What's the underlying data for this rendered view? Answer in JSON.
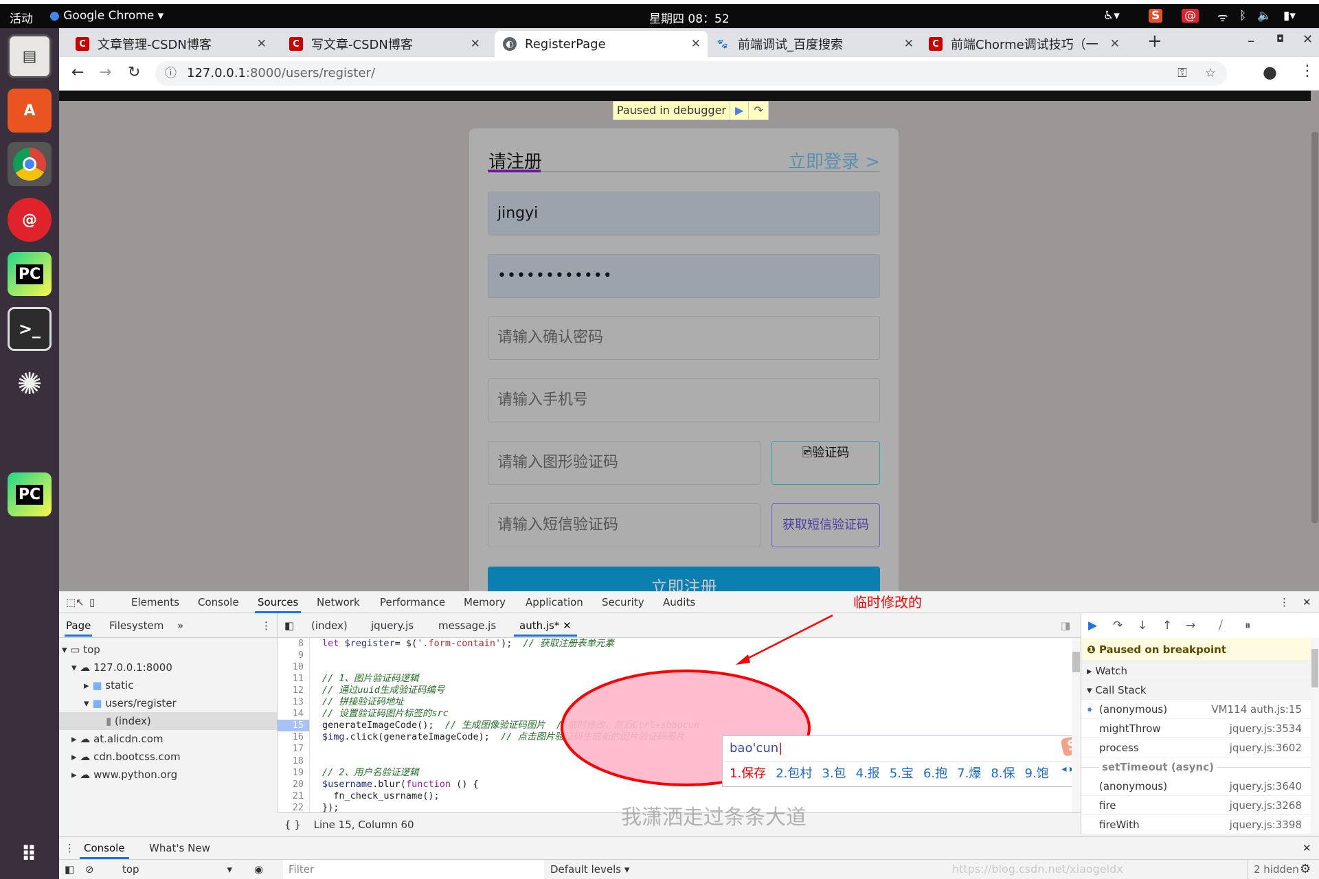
{
  "os": {
    "activities": "活动",
    "app_menu": "Google Chrome ▾",
    "clock": "星期四 08：52"
  },
  "dock": [
    "files-icon",
    "software-icon",
    "chrome-icon",
    "netease-music-icon",
    "pycharm-icon",
    "terminal-icon",
    "inkscape-icon",
    "pycharm-pro-icon",
    "app-grid-icon"
  ],
  "tabs": [
    {
      "title": "文章管理-CSDN博客",
      "fav": "C"
    },
    {
      "title": "写文章-CSDN博客",
      "fav": "C"
    },
    {
      "title": "RegisterPage",
      "fav": ""
    },
    {
      "title": "前端调试_百度搜索",
      "fav": "🐾"
    },
    {
      "title": "前端Chorme调试技巧（一",
      "fav": "C"
    }
  ],
  "address": {
    "host": "127.0.0.1",
    "rest": ":8000/users/register/"
  },
  "debugger_overlay": "Paused in debugger",
  "form": {
    "title": "请注册",
    "login_link": "立即登录 >",
    "username": "jingyi",
    "password": "••••••••••••",
    "confirm_placeholder": "请输入确认密码",
    "mobile_placeholder": "请输入手机号",
    "captcha_placeholder": "请输入图形验证码",
    "captcha_alt": "验证码",
    "sms_placeholder": "请输入短信验证码",
    "sms_button": "获取短信验证码",
    "submit": "立即注册"
  },
  "devtools": {
    "panels": [
      "Elements",
      "Console",
      "Sources",
      "Network",
      "Performance",
      "Memory",
      "Application",
      "Security",
      "Audits"
    ],
    "annotation": "临时修改的",
    "nav_tabs": [
      "Page",
      "Filesystem",
      "»"
    ],
    "tree": [
      "top",
      "127.0.0.1:8000",
      "static",
      "users/register",
      "(index)",
      "at.alicdn.com",
      "cdn.bootcss.com",
      "www.python.org"
    ],
    "files": [
      "(index)",
      "jquery.js",
      "message.js",
      "auth.js*"
    ],
    "code": [
      {
        "n": "8",
        "t": [
          [
            "kw",
            "let "
          ],
          [
            "vr",
            "$register"
          ],
          [
            "",
            "= $("
          ],
          [
            "st",
            "'.form-contain'"
          ],
          [
            "",
            "); "
          ],
          [
            "cm",
            " // 获取注册表单元素"
          ]
        ]
      },
      {
        "n": "9",
        "t": []
      },
      {
        "n": "10",
        "t": []
      },
      {
        "n": "11",
        "t": [
          [
            "cm",
            "// 1、图片验证码逻辑"
          ]
        ]
      },
      {
        "n": "12",
        "t": [
          [
            "cm",
            "// 通过uuid生成验证码编号"
          ]
        ]
      },
      {
        "n": "13",
        "t": [
          [
            "cm",
            "// 拼接验证码地址"
          ]
        ]
      },
      {
        "n": "14",
        "t": [
          [
            "cm",
            "// 设置验证码图片标签的src"
          ]
        ]
      },
      {
        "n": "15",
        "t": [
          [
            "",
            "generateImageCode();  "
          ],
          [
            "cm",
            "// 生成图像验证码图片  //临时修改，然后Ctrl+sbaocun"
          ]
        ]
      },
      {
        "n": "16",
        "t": [
          [
            "vr",
            "$img"
          ],
          [
            "",
            ".click(generateImageCode);  "
          ],
          [
            "cm",
            "// 点击图片验证码生成新的图片验证码图片"
          ]
        ]
      },
      {
        "n": "17",
        "t": []
      },
      {
        "n": "18",
        "t": []
      },
      {
        "n": "19",
        "t": [
          [
            "cm",
            "// 2、用户名验证逻辑"
          ]
        ]
      },
      {
        "n": "20",
        "t": [
          [
            "vr",
            "$username"
          ],
          [
            "",
            ".blur("
          ],
          [
            "kw",
            "function"
          ],
          [
            "",
            " () {"
          ]
        ]
      },
      {
        "n": "21",
        "t": [
          [
            "",
            "  fn_check_usrname();"
          ]
        ]
      },
      {
        "n": "22",
        "t": [
          [
            "",
            "});"
          ]
        ]
      }
    ],
    "ime": {
      "composition": "bao'cun",
      "candidates": [
        "1.保存",
        "2.包村",
        "3.包",
        "4.报",
        "5.宝",
        "6.抱",
        "7.爆",
        "8.保",
        "9.饱"
      ]
    },
    "status": "Line 15, Column 60",
    "watermark": "我潇洒走过条条大道",
    "paused": "Paused on breakpoint",
    "watch": "Watch",
    "callstack": "Call Stack",
    "stack": [
      {
        "fn": "(anonymous)",
        "loc": "VM114 auth.js:15",
        "current": true
      },
      {
        "fn": "mightThrow",
        "loc": "jquery.js:3534"
      },
      {
        "fn": "process",
        "loc": "jquery.js:3602"
      },
      {
        "async": "setTimeout (async)"
      },
      {
        "fn": "(anonymous)",
        "loc": "jquery.js:3640"
      },
      {
        "fn": "fire",
        "loc": "jquery.js:3268"
      },
      {
        "fn": "fireWith",
        "loc": "jquery.js:3398"
      }
    ],
    "drawer_tabs": [
      "Console",
      "What's New"
    ],
    "context": "top",
    "filter_placeholder": "Filter",
    "levels": "Default levels ▾",
    "hidden": "2 hidden",
    "csdn_watermark": "https://blog.csdn.net/xiaogeldx"
  }
}
